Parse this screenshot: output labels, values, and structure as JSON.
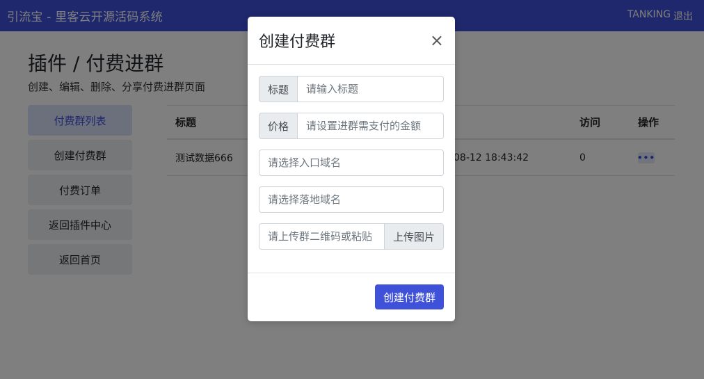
{
  "navbar": {
    "brand": "引流宝 - 里客云开源活码系统",
    "user": "TANKING",
    "logout": "退出"
  },
  "page": {
    "title": "插件 / 付费进群",
    "subtitle": "创建、编辑、删除、分享付费进群页面"
  },
  "sidebar": {
    "items": [
      {
        "label": "付费群列表",
        "active": true
      },
      {
        "label": "创建付费群",
        "active": false
      },
      {
        "label": "付费订单",
        "active": false
      },
      {
        "label": "返回插件中心",
        "active": false
      },
      {
        "label": "返回首页",
        "active": false
      }
    ]
  },
  "table": {
    "headers": [
      "标题",
      "访问",
      "操作"
    ],
    "rows": [
      {
        "title": "测试数据666",
        "time_fragment": "08-12 18:43:42",
        "visits": "0",
        "action_icon": "more-dots-icon"
      }
    ]
  },
  "modal": {
    "title": "创建付费群",
    "close": "×",
    "fields": {
      "title_label": "标题",
      "title_placeholder": "请输入标题",
      "price_label": "价格",
      "price_placeholder": "请设置进群需支付的金额",
      "entry_domain_placeholder": "请选择入口域名",
      "landing_domain_placeholder": "请选择落地域名",
      "qr_placeholder": "请上传群二维码或粘贴",
      "upload_label": "上传图片"
    },
    "submit": "创建付费群"
  },
  "colors": {
    "primary": "#3f51d8",
    "backdrop": "rgba(0,0,0,0.5)"
  }
}
